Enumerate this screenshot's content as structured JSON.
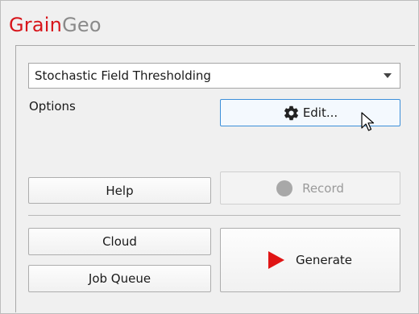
{
  "app": {
    "logo_part1": "Grain",
    "logo_part2": "Geo"
  },
  "method_select": {
    "value": "Stochastic Field Thresholding"
  },
  "options": {
    "label": "Options",
    "edit_label": "Edit..."
  },
  "buttons": {
    "help": "Help",
    "record": "Record",
    "cloud": "Cloud",
    "job_queue": "Job Queue",
    "generate": "Generate"
  },
  "colors": {
    "brand_red": "#d7141a",
    "play_red": "#e01515",
    "hover_blue": "#3c8fd9"
  },
  "icons": {
    "edit": "gear-icon",
    "record": "record-dot-icon",
    "generate": "play-icon",
    "select": "chevron-down-icon"
  }
}
